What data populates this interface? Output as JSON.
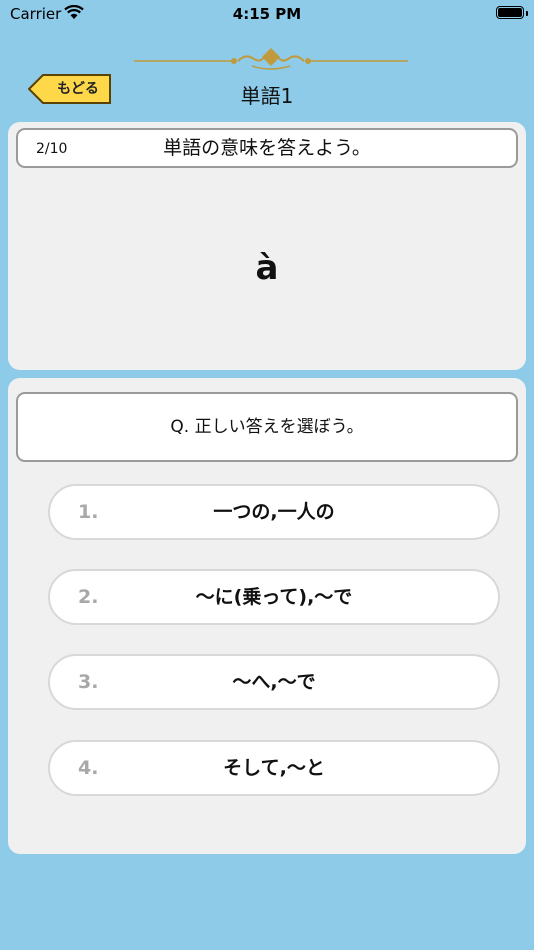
{
  "status_bar": {
    "carrier": "Carrier",
    "time": "4:15 PM"
  },
  "header": {
    "back_label": "もどる",
    "title": "単語1"
  },
  "card": {
    "counter": "2/10",
    "prompt": "単語の意味を答えよう。",
    "word": "à"
  },
  "quiz": {
    "question": "Q. 正しい答えを選ぼう。",
    "choices": [
      {
        "number": "1.",
        "text": "一つの,一人の"
      },
      {
        "number": "2.",
        "text": "～に(乗って),～で"
      },
      {
        "number": "3.",
        "text": "～へ,～で"
      },
      {
        "number": "4.",
        "text": "そして,～と"
      }
    ]
  },
  "colors": {
    "background": "#8dcbe9",
    "panel": "#f0f0f0",
    "back_button": "#ffd84a",
    "ornament": "#c09a3c"
  }
}
